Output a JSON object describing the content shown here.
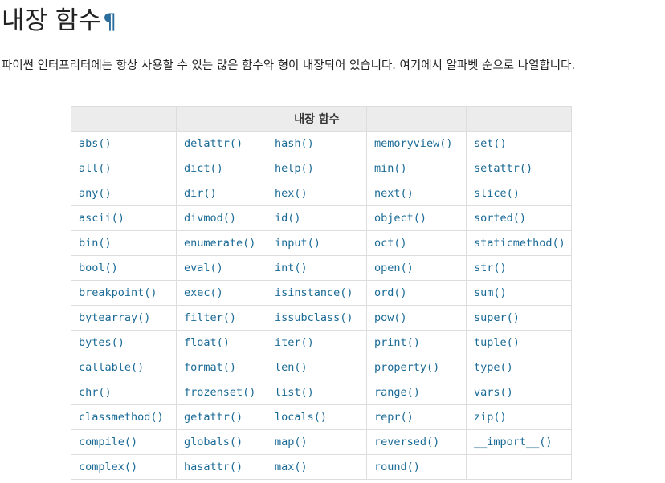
{
  "heading": {
    "title": "내장 함수",
    "permalink": "¶"
  },
  "intro": "파이썬 인터프리터에는 항상 사용할 수 있는 많은 함수와 형이 내장되어 있습니다. 여기에서 알파벳 순으로 나열합니다.",
  "table": {
    "header": "내장 함수",
    "columns": [
      [
        "abs()",
        "all()",
        "any()",
        "ascii()",
        "bin()",
        "bool()",
        "breakpoint()",
        "bytearray()",
        "bytes()",
        "callable()",
        "chr()",
        "classmethod()",
        "compile()",
        "complex()"
      ],
      [
        "delattr()",
        "dict()",
        "dir()",
        "divmod()",
        "enumerate()",
        "eval()",
        "exec()",
        "filter()",
        "float()",
        "format()",
        "frozenset()",
        "getattr()",
        "globals()",
        "hasattr()"
      ],
      [
        "hash()",
        "help()",
        "hex()",
        "id()",
        "input()",
        "int()",
        "isinstance()",
        "issubclass()",
        "iter()",
        "len()",
        "list()",
        "locals()",
        "map()",
        "max()"
      ],
      [
        "memoryview()",
        "min()",
        "next()",
        "object()",
        "oct()",
        "open()",
        "ord()",
        "pow()",
        "print()",
        "property()",
        "range()",
        "repr()",
        "reversed()",
        "round()"
      ],
      [
        "set()",
        "setattr()",
        "slice()",
        "sorted()",
        "staticmethod()",
        "str()",
        "sum()",
        "super()",
        "tuple()",
        "type()",
        "vars()",
        "zip()",
        "__import__()",
        ""
      ]
    ]
  }
}
